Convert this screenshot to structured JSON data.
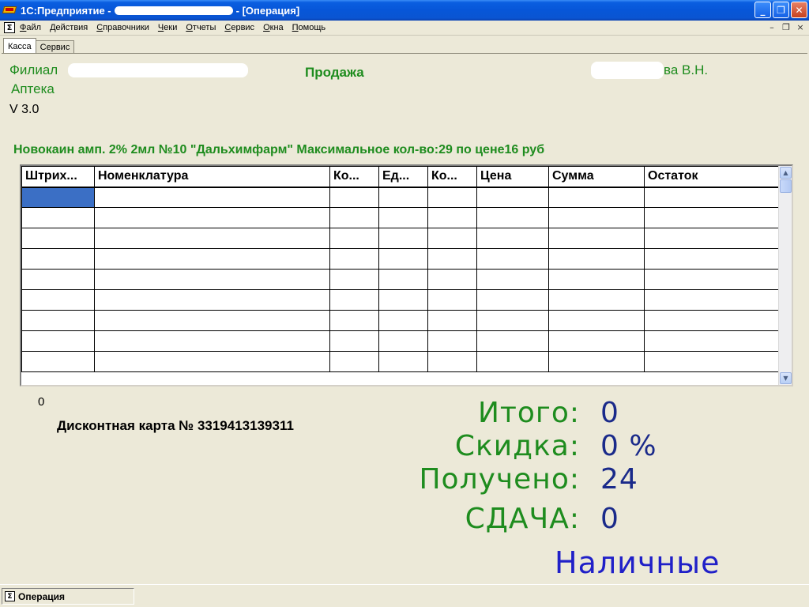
{
  "window": {
    "title_prefix": "1С:Предприятие -",
    "title_suffix": "- [Операция]",
    "minimize": "_",
    "maximize": "❐",
    "close": "✕"
  },
  "menu": {
    "sys_icon": "Σ",
    "items": [
      "Файл",
      "Действия",
      "Справочники",
      "Чеки",
      "Отчеты",
      "Сервис",
      "Окна",
      "Помощь"
    ],
    "mdi_minimize": "–",
    "mdi_restore": "❐",
    "mdi_close": "×"
  },
  "tabs": [
    {
      "label": "Касса",
      "active": true
    },
    {
      "label": "Сервис",
      "active": false
    }
  ],
  "header": {
    "branch_label": "Филиал",
    "pharmacy_label": "Аптека",
    "version": "V 3.0",
    "mode": "Продажа",
    "cashier_suffix": "ва В.Н."
  },
  "product_line": "Новокаин амп. 2% 2мл №10 \"Дальхимфарм\" Максимальное кол-во:29  по цене16 руб",
  "grid": {
    "columns": [
      "Штрих...",
      "Номенклатура",
      "Ко...",
      "Ед...",
      "Ко...",
      "Цена",
      "Сумма",
      "Остаток"
    ],
    "rows": 9
  },
  "count_value": "0",
  "discount_card": "Дисконтная карта № 3319413139311",
  "totals": {
    "total_label": "Итого:",
    "total_value": "0",
    "discount_label": "Скидка:",
    "discount_value": "0 %",
    "received_label": "Получено:",
    "received_value": "24",
    "change_label": "СДАЧА:",
    "change_value": "0",
    "payment_type": "Наличные"
  },
  "statusbar": {
    "icon": "Σ",
    "label": "Операция"
  },
  "colors": {
    "accent_green": "#1e8c1e",
    "value_blue": "#1a2a8a",
    "payment_blue": "#2020c8",
    "selection": "#3b6fc5"
  }
}
